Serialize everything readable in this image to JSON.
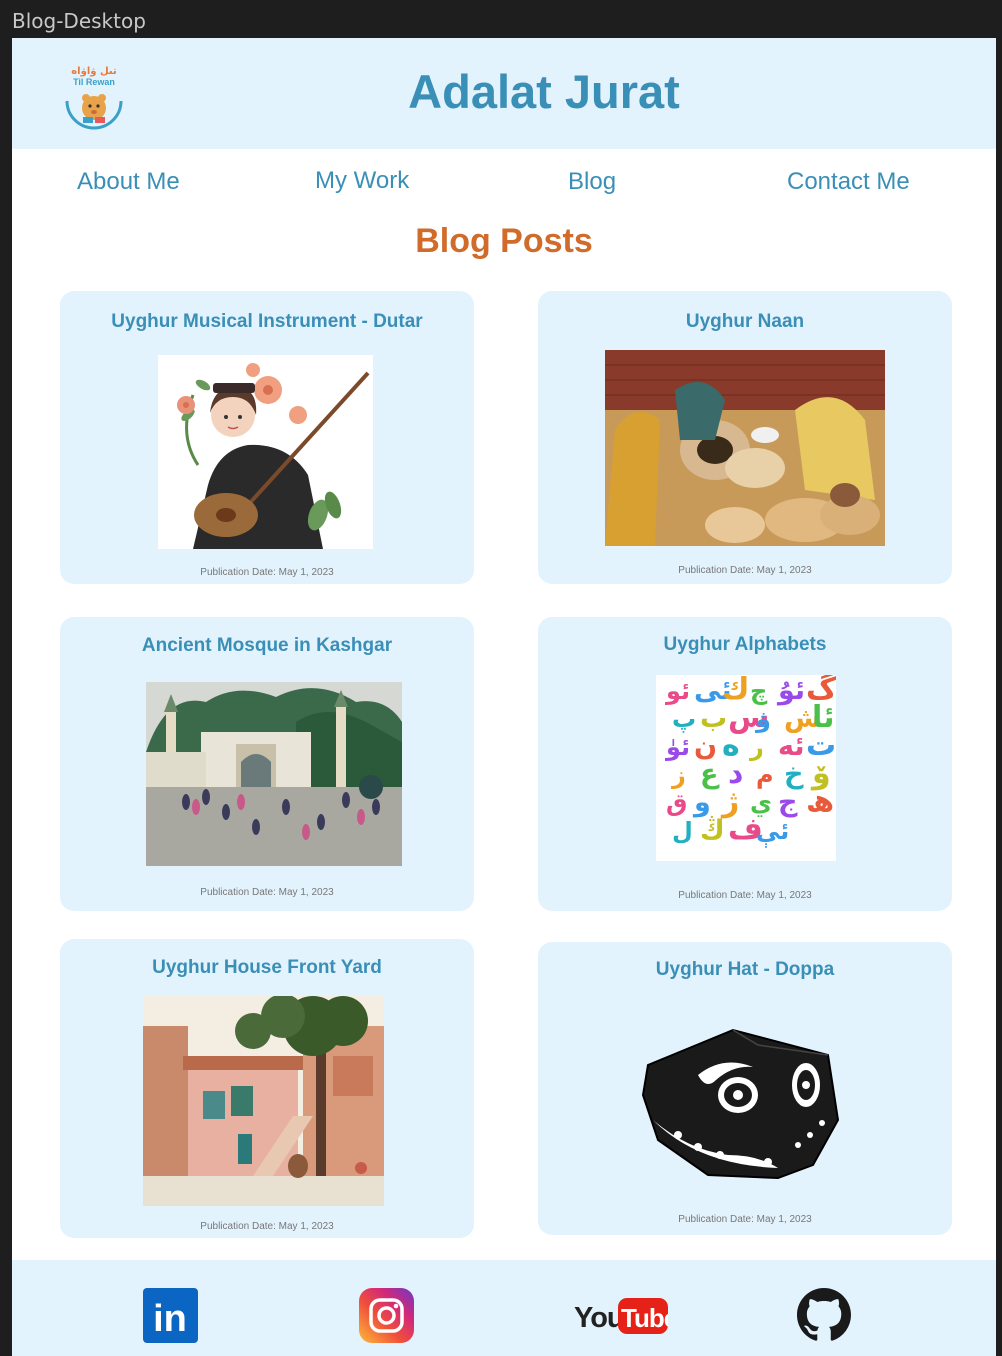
{
  "frame": {
    "label": "Blog-Desktop"
  },
  "header": {
    "logo": {
      "text_top": "تىل ۋاۋاە",
      "text_bottom": "Til Rewan"
    },
    "title": "Adalat Jurat"
  },
  "nav": {
    "about": "About Me",
    "work": "My Work",
    "blog": "Blog",
    "contact": "Contact Me"
  },
  "section": {
    "title": "Blog Posts"
  },
  "posts": [
    {
      "title": "Uyghur Musical Instrument - Dutar",
      "date": "Publication Date: May 1, 2023"
    },
    {
      "title": "Uyghur Naan",
      "date": "Publication Date: May 1, 2023"
    },
    {
      "title": "Ancient Mosque in Kashgar",
      "date": "Publication Date: May 1, 2023"
    },
    {
      "title": "Uyghur Alphabets",
      "date": "Publication Date: May 1, 2023"
    },
    {
      "title": "Uyghur House Front Yard",
      "date": "Publication Date: May 1, 2023"
    },
    {
      "title": "Uyghur Hat - Doppa",
      "date": "Publication Date: May 1, 2023"
    }
  ],
  "alphabet_letters": [
    "ئو",
    "ئى",
    "ك",
    "چ",
    "ئۇ",
    "گ",
    "پ",
    "ب",
    "س",
    "ۋ",
    "ش",
    "ئا",
    "ئۈ",
    "ن",
    "ە",
    "ر",
    "ئە",
    "ت",
    "ز",
    "ع",
    "د",
    "م",
    "خ",
    "ۆ",
    "ق",
    "و",
    "ژ",
    "ي",
    "ج",
    "ھ",
    "ل",
    "ڭ",
    "ف",
    "ئې"
  ],
  "footer": {
    "linkedin": "in",
    "youtube_you": "You",
    "youtube_tube": "Tube",
    "icons": [
      "linkedin-icon",
      "instagram-icon",
      "youtube-icon",
      "github-icon"
    ]
  },
  "colors": {
    "accent_blue": "#3a8fb7",
    "accent_orange": "#d06b2a",
    "card_bg": "#e3f3fd",
    "linkedin": "#0a66c2",
    "youtube": "#e62117"
  }
}
